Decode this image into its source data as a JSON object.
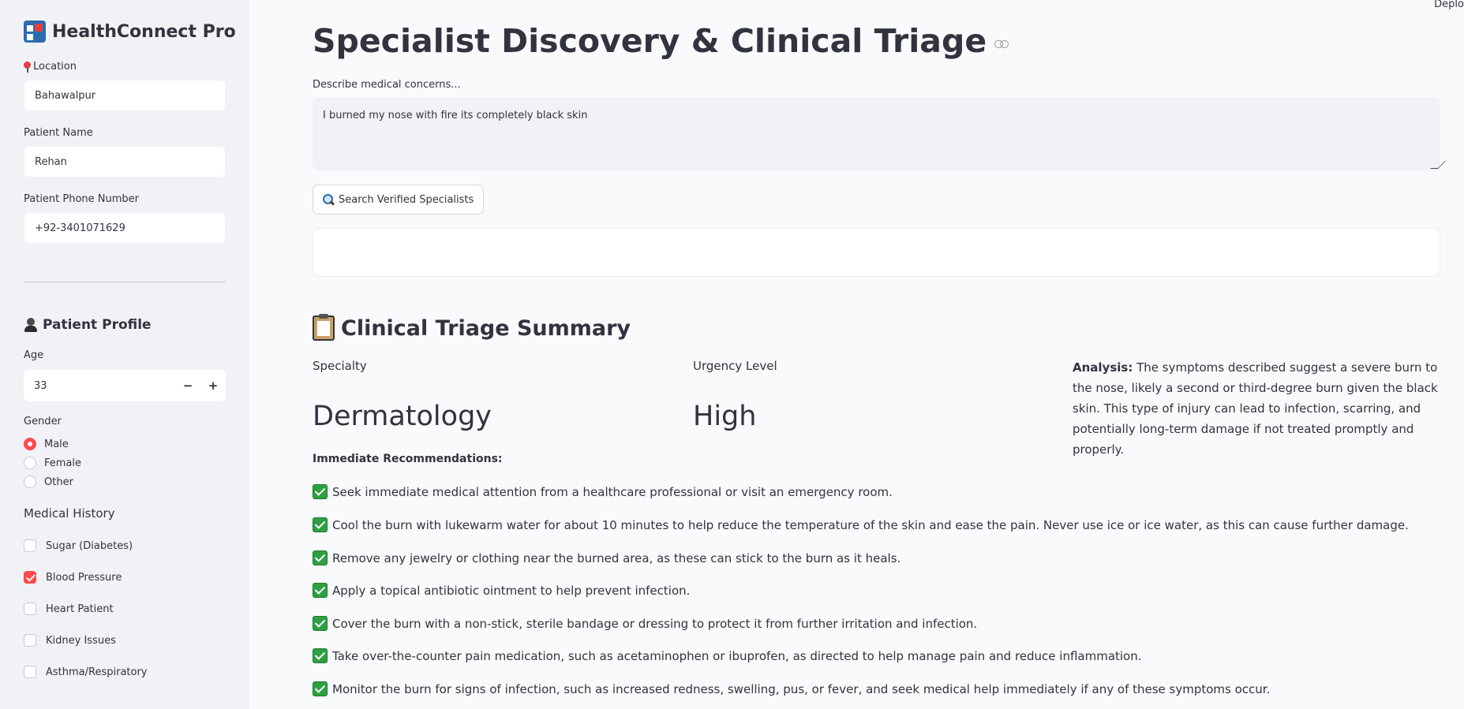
{
  "app": {
    "title": "HealthConnect Pro",
    "deploy_label": "Deplo"
  },
  "sidebar": {
    "location": {
      "label": "Location",
      "value": "Bahawalpur"
    },
    "patient_name": {
      "label": "Patient Name",
      "value": "Rehan"
    },
    "phone": {
      "label": "Patient Phone Number",
      "value": "+92-3401071629"
    },
    "profile_title": "Patient Profile",
    "age": {
      "label": "Age",
      "value": "33",
      "minus": "−",
      "plus": "+"
    },
    "gender": {
      "label": "Gender",
      "selected": "Male",
      "options": [
        "Male",
        "Female",
        "Other"
      ]
    },
    "history": {
      "label": "Medical History",
      "items": [
        {
          "label": "Sugar (Diabetes)",
          "checked": false
        },
        {
          "label": "Blood Pressure",
          "checked": true
        },
        {
          "label": "Heart Patient",
          "checked": false
        },
        {
          "label": "Kidney Issues",
          "checked": false
        },
        {
          "label": "Asthma/Respiratory",
          "checked": false
        }
      ]
    }
  },
  "main": {
    "title": "Specialist Discovery & Clinical Triage",
    "concern_label": "Describe medical concerns...",
    "concern_value": "I burned my nose with fire its completely black skin",
    "search_button": "Search Verified Specialists",
    "summary_title": "Clinical Triage Summary",
    "specialty": {
      "label": "Specialty",
      "value": "Dermatology"
    },
    "urgency": {
      "label": "Urgency Level",
      "value": "High"
    },
    "analysis": {
      "label": "Analysis:",
      "text": "The symptoms described suggest a severe burn to the nose, likely a second or third-degree burn given the black skin. This type of injury can lead to infection, scarring, and potentially long-term damage if not treated promptly and properly."
    },
    "recommendations_title": "Immediate Recommendations:",
    "recommendations": [
      "Seek immediate medical attention from a healthcare professional or visit an emergency room.",
      "Cool the burn with lukewarm water for about 10 minutes to help reduce the temperature of the skin and ease the pain. Never use ice or ice water, as this can cause further damage.",
      "Remove any jewelry or clothing near the burned area, as these can stick to the burn as it heals.",
      "Apply a topical antibiotic ointment to help prevent infection.",
      "Cover the burn with a non-stick, sterile bandage or dressing to protect it from further irritation and infection.",
      "Take over-the-counter pain medication, such as acetaminophen or ibuprofen, as directed to help manage pain and reduce inflammation.",
      "Monitor the burn for signs of infection, such as increased redness, swelling, pus, or fever, and seek medical help immediately if any of these symptoms occur."
    ]
  },
  "colors": {
    "accent": "#ff4b4b",
    "sidebar_bg": "#f0f2f6",
    "check_green": "#2ea043"
  }
}
